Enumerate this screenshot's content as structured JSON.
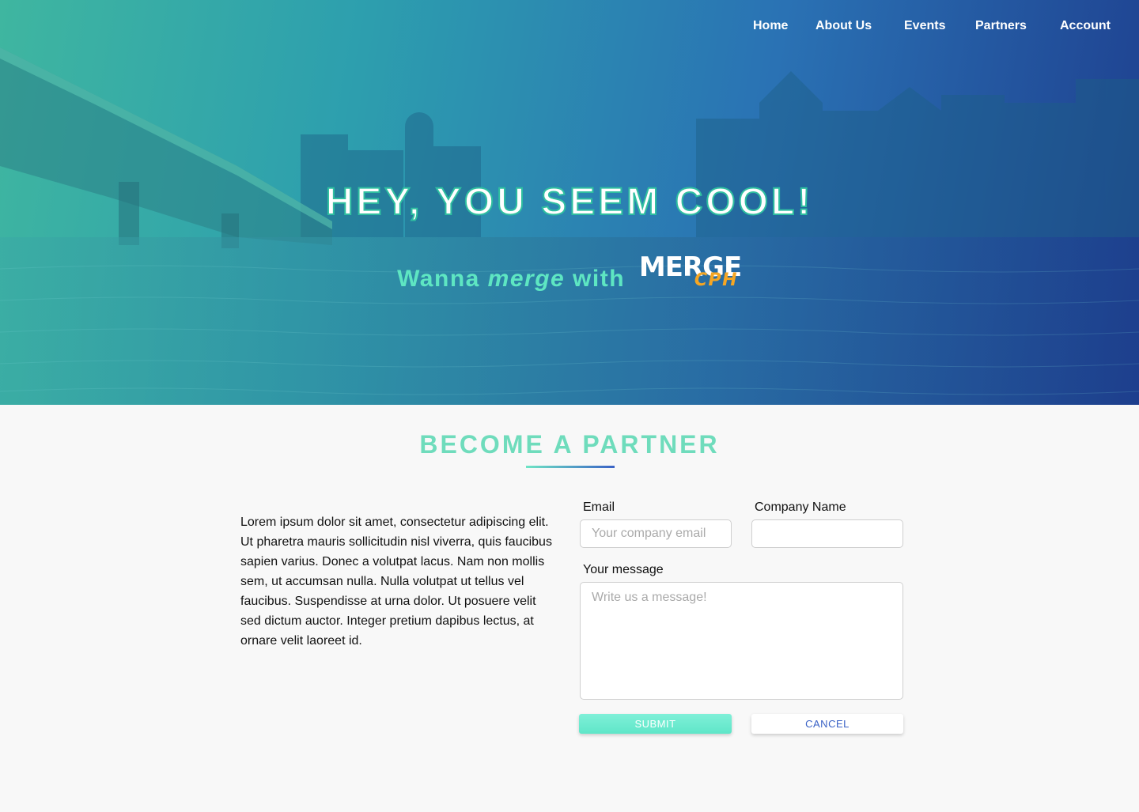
{
  "nav": {
    "items": [
      "Home",
      "About Us",
      "Events",
      "Partners",
      "Account"
    ]
  },
  "hero": {
    "title": "HEY, YOU SEEM COOL!",
    "tagline_pre": "Wanna ",
    "tagline_em": "merge",
    "tagline_post": " with ",
    "logo_main": "MERGE",
    "logo_sub": "CPH"
  },
  "partner": {
    "title": "BECOME A PARTNER",
    "description": "Lorem ipsum dolor sit amet, consectetur adipiscing elit. Ut pharetra mauris sollicitudin nisl viverra, quis faucibus sapien varius. Donec a volutpat lacus. Nam non mollis sem, ut accumsan nulla. Nulla volutpat ut tellus vel faucibus. Suspendisse at urna dolor. Ut posuere velit sed dictum auctor. Integer pretium dapibus lectus, at ornare velit laoreet id."
  },
  "form": {
    "email_label": "Email",
    "email_placeholder": "Your company email",
    "email_value": "",
    "company_label": "Company Name",
    "company_placeholder": "",
    "company_value": "",
    "message_label": "Your message",
    "message_placeholder": "Write us a message!",
    "submit_label": "SUBMIT",
    "cancel_label": "CANCEL"
  },
  "colors": {
    "accent_mint": "#6fdcbc",
    "accent_blue": "#3a62c6",
    "logo_orange": "#f5a623"
  }
}
